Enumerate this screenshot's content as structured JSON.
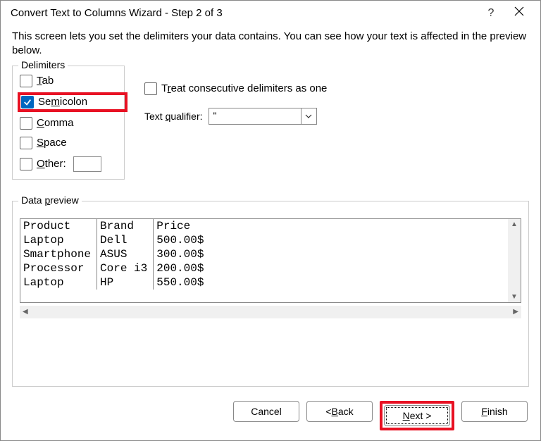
{
  "title": "Convert Text to Columns Wizard - Step 2 of 3",
  "intro": "This screen lets you set the delimiters your data contains.  You can see how your text is affected in the preview below.",
  "delimitersLegend": "Delimiters",
  "delims": {
    "tab": "Tab",
    "semicolon": "Semicolon",
    "comma": "Comma",
    "space": "Space",
    "other": "Other:"
  },
  "treatConsec": "Treat consecutive delimiters as one",
  "qualifierLabel": "Text qualifier:",
  "qualifierValue": "\"",
  "previewLegend": "Data preview",
  "previewCols": [
    "Product",
    "Brand",
    "Price"
  ],
  "previewRows": [
    [
      "Laptop",
      "Dell",
      "500.00$"
    ],
    [
      "Smartphone",
      "ASUS",
      "300.00$"
    ],
    [
      "Processor",
      "Core i3",
      "200.00$"
    ],
    [
      "Laptop",
      "HP",
      "550.00$"
    ]
  ],
  "buttons": {
    "cancel": "Cancel",
    "back": "< Back",
    "next": "Next >",
    "finish": "Finish"
  }
}
